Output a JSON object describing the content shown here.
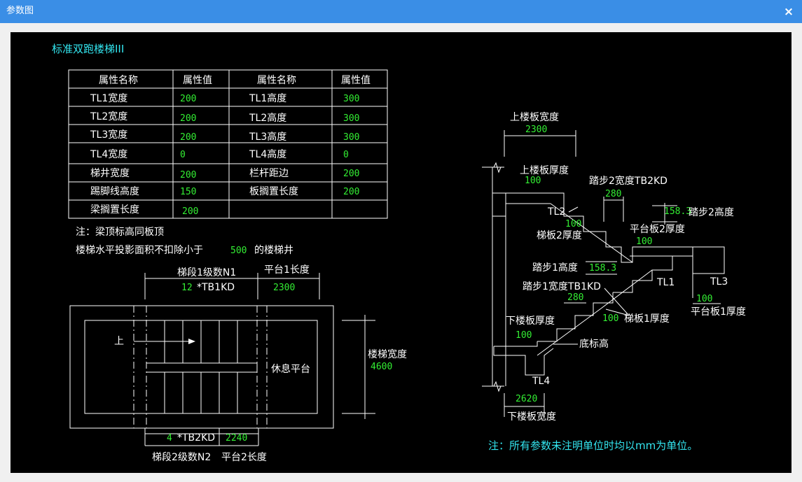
{
  "window": {
    "title": "参数图",
    "close_glyph": "×"
  },
  "diagram": {
    "heading": "标准双跑楼梯III",
    "table": {
      "headers": [
        "属性名称",
        "属性值",
        "属性名称",
        "属性值"
      ],
      "rows": [
        [
          "TL1宽度",
          "200",
          "TL1高度",
          "300"
        ],
        [
          "TL2宽度",
          "200",
          "TL2高度",
          "300"
        ],
        [
          "TL3宽度",
          "200",
          "TL3高度",
          "300"
        ],
        [
          "TL4宽度",
          "0",
          "TL4高度",
          "0"
        ],
        [
          "梯井宽度",
          "200",
          "栏杆距边",
          "200"
        ],
        [
          "踢脚线高度",
          "150",
          "板搁置长度",
          "200"
        ],
        [
          "梁搁置长度",
          "200",
          "",
          ""
        ]
      ]
    },
    "note_beam": "注：梁顶标高同板顶",
    "note_area_prefix": "楼梯水平投影面积不扣除小于",
    "note_area_value": "500",
    "note_area_suffix": "的楼梯井",
    "plan": {
      "flight1_label": "梯段1级数N1",
      "flight1_count": "12",
      "flight1_suffix": "*TB1KD",
      "landing1_label": "平台1长度",
      "landing1_value": "2300",
      "up_label": "上",
      "rest_label": "休息平台",
      "width_label": "楼梯宽度",
      "width_value": "4600",
      "flight2_count": "4",
      "flight2_suffix": "*TB2KD",
      "landing2_value": "2240",
      "flight2_label": "梯段2级数N2",
      "landing2_label": "平台2长度"
    },
    "section": {
      "upper_slab_width_label": "上楼板宽度",
      "upper_slab_width_value": "2300",
      "upper_slab_thk_label": "上楼板厚度",
      "upper_slab_thk_value": "100",
      "tread2_width_label": "踏步2宽度TB2KD",
      "tread2_width_value": "280",
      "tread2_height_value": "158.3",
      "tread2_height_label": "踏步2高度",
      "tl2_label": "TL2",
      "slab2_thk_value": "100",
      "slab2_thk_label": "梯板2厚度",
      "landing2_thk_label": "平台板2厚度",
      "landing2_thk_value": "100",
      "tread1_height_label": "踏步1高度",
      "tread1_height_value": "158.3",
      "tread1_width_label": "踏步1宽度TB1KD",
      "tread1_width_value": "280",
      "tl1_label": "TL1",
      "tl3_label": "TL3",
      "landing1_thk_value": "100",
      "landing1_thk_label": "平台板1厚度",
      "lower_slab_thk_label": "下楼板厚度",
      "lower_slab_thk_value": "100",
      "slab1_thk_value": "100",
      "slab1_thk_label": "梯板1厚度",
      "base_elev_label": "底标高",
      "tl4_label": "TL4",
      "lower_slab_width_value": "2620",
      "lower_slab_width_label": "下楼板宽度"
    },
    "footer_note": "注：所有参数未注明单位时均以mm为单位。"
  }
}
